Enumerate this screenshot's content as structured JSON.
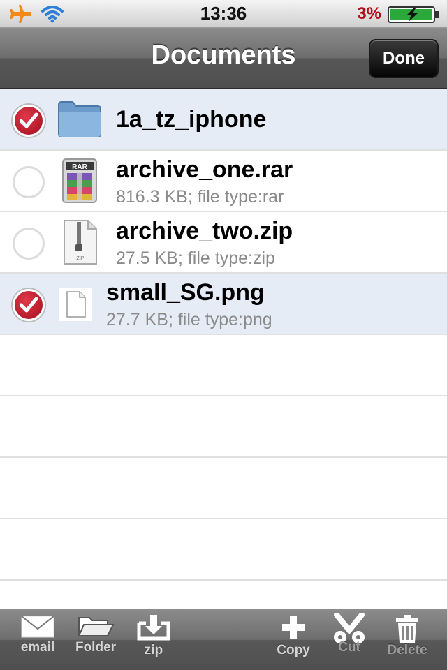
{
  "status_bar": {
    "time": "13:36",
    "battery_percent": "3%"
  },
  "nav_bar": {
    "title": "Documents",
    "done_label": "Done"
  },
  "files": [
    {
      "name": "1a_tz_iphone",
      "meta": "",
      "icon": "folder-icon",
      "selected": true
    },
    {
      "name": "archive_one.rar",
      "meta": "816.3 KB; file type:rar",
      "icon": "rar-file-icon",
      "selected": false
    },
    {
      "name": "archive_two.zip",
      "meta": "27.5 KB; file type:zip",
      "icon": "zip-file-icon",
      "selected": false
    },
    {
      "name": "small_SG.png",
      "meta": "27.7 KB; file type:png",
      "icon": "png-file-icon",
      "selected": true
    }
  ],
  "rar_icon_text": "RAR",
  "zip_icon_text": "ZIP",
  "toolbar": {
    "email": "email",
    "folder": "Folder",
    "zip": "zip",
    "copy": "Copy",
    "cut": "Cut",
    "delete": "Delete"
  },
  "colors": {
    "selected_row": "#e6ecf6",
    "checkmark_red": "#b01426",
    "battery_text": "#b00d1a"
  }
}
